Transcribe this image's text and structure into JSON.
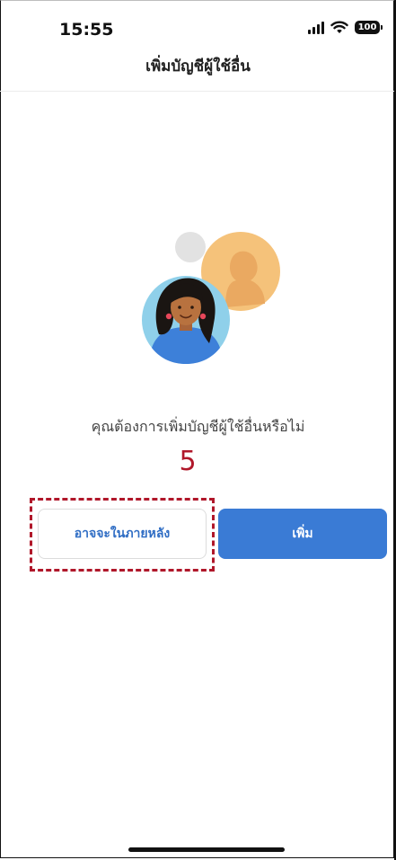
{
  "status_bar": {
    "time": "15:55",
    "battery": "100"
  },
  "header": {
    "title": "เพิ่มบัญชีผู้ใช้อื่น"
  },
  "main": {
    "prompt": "คุณต้องการเพิ่มบัญชีผู้ใช้อื่นหรือไม่",
    "step_number": "5",
    "later_button_label": "อาจจะในภายหลัง",
    "add_button_label": "เพิ่ม"
  },
  "colors": {
    "accent_blue": "#3a7bd5",
    "link_blue": "#2f6dc4",
    "annotation_red": "#b0172a"
  },
  "icons": {
    "signal": "cellular-signal-icon",
    "wifi": "wifi-icon",
    "battery": "battery-icon",
    "illustration": "add-account-people-illustration"
  }
}
